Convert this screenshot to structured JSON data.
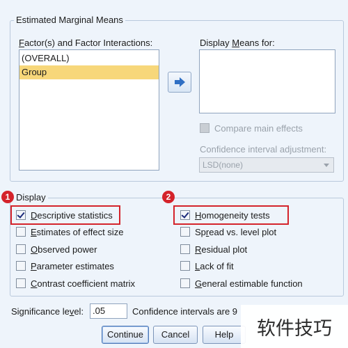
{
  "emm": {
    "title": "Estimated Marginal Means",
    "factors_label_pre": "F",
    "factors_label_post": "actor(s) and Factor Interactions:",
    "factors": [
      "(OVERALL)",
      "Group"
    ],
    "selected_factor_index": 1,
    "display_means_pre": "Display ",
    "display_means_key": "M",
    "display_means_post": "eans for:",
    "move_icon": "right-arrow-icon",
    "compare_main_effects": "Compare main effects",
    "ci_adjustment_label": "Confidence interval adjustment:",
    "ci_adjustment_value": "LSD(none)"
  },
  "display": {
    "title": "Display",
    "left": [
      {
        "pre": "",
        "key": "D",
        "post": "escriptive statistics",
        "checked": true
      },
      {
        "pre": "",
        "key": "E",
        "post": "stimates of effect size",
        "checked": false
      },
      {
        "pre": "",
        "key": "O",
        "post": "bserved power",
        "checked": false
      },
      {
        "pre": "",
        "key": "P",
        "post": "arameter estimates",
        "checked": false
      },
      {
        "pre": "",
        "key": "C",
        "post": "ontrast coefficient matrix",
        "checked": false
      }
    ],
    "right": [
      {
        "pre": "",
        "key": "H",
        "post": "omogeneity tests",
        "checked": true
      },
      {
        "pre": "Sp",
        "key": "r",
        "post": "ead vs. level plot",
        "checked": false
      },
      {
        "pre": "",
        "key": "R",
        "post": "esidual plot",
        "checked": false
      },
      {
        "pre": "",
        "key": "L",
        "post": "ack of fit",
        "checked": false
      },
      {
        "pre": "",
        "key": "G",
        "post": "eneral estimable function",
        "checked": false
      }
    ],
    "badges": [
      "1",
      "2"
    ]
  },
  "significance": {
    "label_pre": "Significance le",
    "label_key": "v",
    "label_post": "el:",
    "value": ".05",
    "ci_text": "Confidence intervals are 9"
  },
  "buttons": {
    "continue": "Continue",
    "cancel": "Cancel",
    "help": "Help"
  },
  "watermark": "软件技巧",
  "colors": {
    "highlight": "#d4232b",
    "selected_row": "#f7d77a",
    "background": "#eef4fb"
  }
}
